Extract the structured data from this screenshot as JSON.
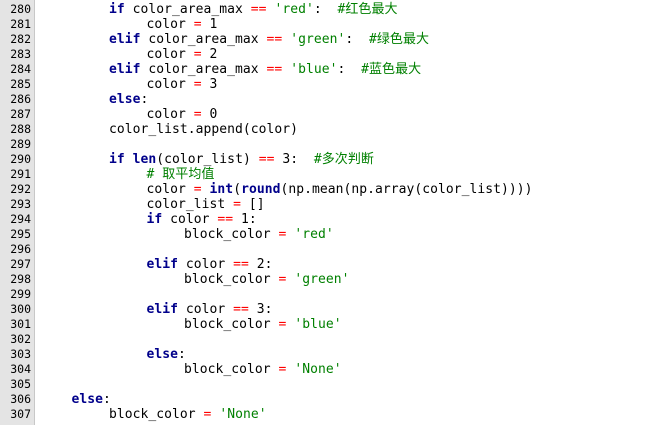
{
  "colors": {
    "keyword": "#00008b",
    "operator": "#ff0000",
    "string": "#008000",
    "comment": "#008000",
    "gutter": "#e4e4e4"
  },
  "lines": [
    {
      "n": "280",
      "indent": 2,
      "tokens": [
        {
          "t": "kw",
          "v": "if"
        },
        {
          "t": "tx",
          "v": " color_area_max "
        },
        {
          "t": "op",
          "v": "=="
        },
        {
          "t": "tx",
          "v": " "
        },
        {
          "t": "str",
          "v": "'red'"
        },
        {
          "t": "tx",
          "v": ":  "
        },
        {
          "t": "cm",
          "v": "#红色最大"
        }
      ]
    },
    {
      "n": "281",
      "indent": 3,
      "tokens": [
        {
          "t": "tx",
          "v": "color "
        },
        {
          "t": "op",
          "v": "="
        },
        {
          "t": "tx",
          "v": " 1"
        }
      ]
    },
    {
      "n": "282",
      "indent": 2,
      "tokens": [
        {
          "t": "kw",
          "v": "elif"
        },
        {
          "t": "tx",
          "v": " color_area_max "
        },
        {
          "t": "op",
          "v": "=="
        },
        {
          "t": "tx",
          "v": " "
        },
        {
          "t": "str",
          "v": "'green'"
        },
        {
          "t": "tx",
          "v": ":  "
        },
        {
          "t": "cm",
          "v": "#绿色最大"
        }
      ]
    },
    {
      "n": "283",
      "indent": 3,
      "tokens": [
        {
          "t": "tx",
          "v": "color "
        },
        {
          "t": "op",
          "v": "="
        },
        {
          "t": "tx",
          "v": " 2"
        }
      ]
    },
    {
      "n": "284",
      "indent": 2,
      "tokens": [
        {
          "t": "kw",
          "v": "elif"
        },
        {
          "t": "tx",
          "v": " color_area_max "
        },
        {
          "t": "op",
          "v": "=="
        },
        {
          "t": "tx",
          "v": " "
        },
        {
          "t": "str",
          "v": "'blue'"
        },
        {
          "t": "tx",
          "v": ":  "
        },
        {
          "t": "cm",
          "v": "#蓝色最大"
        }
      ]
    },
    {
      "n": "285",
      "indent": 3,
      "tokens": [
        {
          "t": "tx",
          "v": "color "
        },
        {
          "t": "op",
          "v": "="
        },
        {
          "t": "tx",
          "v": " 3"
        }
      ]
    },
    {
      "n": "286",
      "indent": 2,
      "tokens": [
        {
          "t": "kw",
          "v": "else"
        },
        {
          "t": "tx",
          "v": ":"
        }
      ]
    },
    {
      "n": "287",
      "indent": 3,
      "tokens": [
        {
          "t": "tx",
          "v": "color "
        },
        {
          "t": "op",
          "v": "="
        },
        {
          "t": "tx",
          "v": " 0"
        }
      ]
    },
    {
      "n": "288",
      "indent": 2,
      "tokens": [
        {
          "t": "tx",
          "v": "color_list.append(color)"
        }
      ]
    },
    {
      "n": "289",
      "indent": 0,
      "tokens": []
    },
    {
      "n": "290",
      "indent": 2,
      "tokens": [
        {
          "t": "kw",
          "v": "if"
        },
        {
          "t": "tx",
          "v": " "
        },
        {
          "t": "kw",
          "v": "len"
        },
        {
          "t": "tx",
          "v": "(color_list) "
        },
        {
          "t": "op",
          "v": "=="
        },
        {
          "t": "tx",
          "v": " 3:  "
        },
        {
          "t": "cm",
          "v": "#多次判断"
        }
      ]
    },
    {
      "n": "291",
      "indent": 3,
      "tokens": [
        {
          "t": "cm",
          "v": "# 取平均值"
        }
      ]
    },
    {
      "n": "292",
      "indent": 3,
      "tokens": [
        {
          "t": "tx",
          "v": "color "
        },
        {
          "t": "op",
          "v": "="
        },
        {
          "t": "tx",
          "v": " "
        },
        {
          "t": "kw",
          "v": "int"
        },
        {
          "t": "tx",
          "v": "("
        },
        {
          "t": "kw",
          "v": "round"
        },
        {
          "t": "tx",
          "v": "(np.mean(np.array(color_list))))"
        }
      ]
    },
    {
      "n": "293",
      "indent": 3,
      "tokens": [
        {
          "t": "tx",
          "v": "color_list "
        },
        {
          "t": "op",
          "v": "="
        },
        {
          "t": "tx",
          "v": " []"
        }
      ]
    },
    {
      "n": "294",
      "indent": 3,
      "tokens": [
        {
          "t": "kw",
          "v": "if"
        },
        {
          "t": "tx",
          "v": " color "
        },
        {
          "t": "op",
          "v": "=="
        },
        {
          "t": "tx",
          "v": " 1:"
        }
      ]
    },
    {
      "n": "295",
      "indent": 4,
      "tokens": [
        {
          "t": "tx",
          "v": "block_color "
        },
        {
          "t": "op",
          "v": "="
        },
        {
          "t": "tx",
          "v": " "
        },
        {
          "t": "str",
          "v": "'red'"
        }
      ]
    },
    {
      "n": "296",
      "indent": 0,
      "tokens": []
    },
    {
      "n": "297",
      "indent": 3,
      "tokens": [
        {
          "t": "kw",
          "v": "elif"
        },
        {
          "t": "tx",
          "v": " color "
        },
        {
          "t": "op",
          "v": "=="
        },
        {
          "t": "tx",
          "v": " 2:"
        }
      ]
    },
    {
      "n": "298",
      "indent": 4,
      "tokens": [
        {
          "t": "tx",
          "v": "block_color "
        },
        {
          "t": "op",
          "v": "="
        },
        {
          "t": "tx",
          "v": " "
        },
        {
          "t": "str",
          "v": "'green'"
        }
      ]
    },
    {
      "n": "299",
      "indent": 0,
      "tokens": []
    },
    {
      "n": "300",
      "indent": 3,
      "tokens": [
        {
          "t": "kw",
          "v": "elif"
        },
        {
          "t": "tx",
          "v": " color "
        },
        {
          "t": "op",
          "v": "=="
        },
        {
          "t": "tx",
          "v": " 3:"
        }
      ]
    },
    {
      "n": "301",
      "indent": 4,
      "tokens": [
        {
          "t": "tx",
          "v": "block_color "
        },
        {
          "t": "op",
          "v": "="
        },
        {
          "t": "tx",
          "v": " "
        },
        {
          "t": "str",
          "v": "'blue'"
        }
      ]
    },
    {
      "n": "302",
      "indent": 0,
      "tokens": []
    },
    {
      "n": "303",
      "indent": 3,
      "tokens": [
        {
          "t": "kw",
          "v": "else"
        },
        {
          "t": "tx",
          "v": ":"
        }
      ]
    },
    {
      "n": "304",
      "indent": 4,
      "tokens": [
        {
          "t": "tx",
          "v": "block_color "
        },
        {
          "t": "op",
          "v": "="
        },
        {
          "t": "tx",
          "v": " "
        },
        {
          "t": "str",
          "v": "'None'"
        }
      ]
    },
    {
      "n": "305",
      "indent": 0,
      "tokens": []
    },
    {
      "n": "306",
      "indent": 1,
      "tokens": [
        {
          "t": "kw",
          "v": "else"
        },
        {
          "t": "tx",
          "v": ":"
        }
      ]
    },
    {
      "n": "307",
      "indent": 2,
      "tokens": [
        {
          "t": "tx",
          "v": "block_color "
        },
        {
          "t": "op",
          "v": "="
        },
        {
          "t": "tx",
          "v": " "
        },
        {
          "t": "str",
          "v": "'None'"
        }
      ]
    }
  ]
}
